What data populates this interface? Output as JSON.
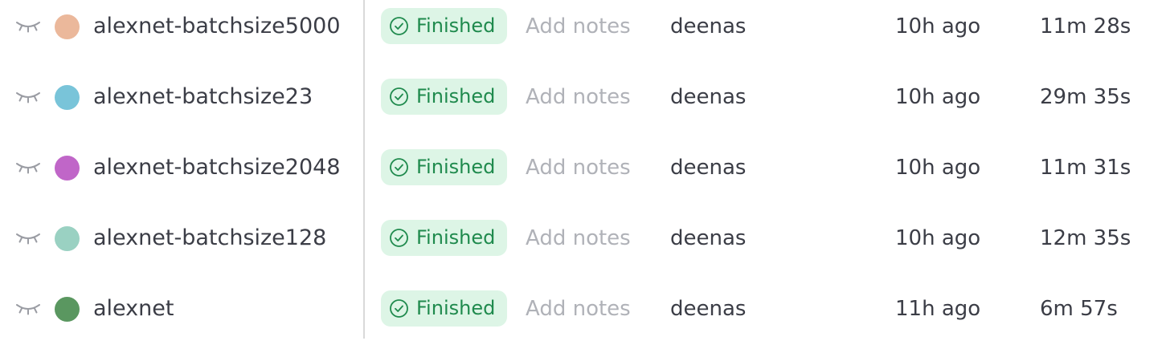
{
  "runs": [
    {
      "name": "alexnet-batchsize5000",
      "color": "#ebb89b",
      "state": "Finished",
      "notes_placeholder": "Add notes",
      "user": "deenas",
      "created": "10h ago",
      "runtime": "11m 28s"
    },
    {
      "name": "alexnet-batchsize23",
      "color": "#79c4d9",
      "state": "Finished",
      "notes_placeholder": "Add notes",
      "user": "deenas",
      "created": "10h ago",
      "runtime": "29m 35s"
    },
    {
      "name": "alexnet-batchsize2048",
      "color": "#c066c8",
      "state": "Finished",
      "notes_placeholder": "Add notes",
      "user": "deenas",
      "created": "10h ago",
      "runtime": "11m 31s"
    },
    {
      "name": "alexnet-batchsize128",
      "color": "#9ad1c2",
      "state": "Finished",
      "notes_placeholder": "Add notes",
      "user": "deenas",
      "created": "10h ago",
      "runtime": "12m 35s"
    },
    {
      "name": "alexnet",
      "color": "#5a9760",
      "state": "Finished",
      "notes_placeholder": "Add notes",
      "user": "deenas",
      "created": "11h ago",
      "runtime": "6m 57s"
    }
  ],
  "icons": {
    "visibility": "eye-closed-icon",
    "state": "check-circle-icon"
  },
  "colors": {
    "state_bg": "#ddf5e6",
    "state_text": "#1f8a4d",
    "notes_placeholder": "#b0b2b8",
    "divider": "#d9d9d9"
  }
}
